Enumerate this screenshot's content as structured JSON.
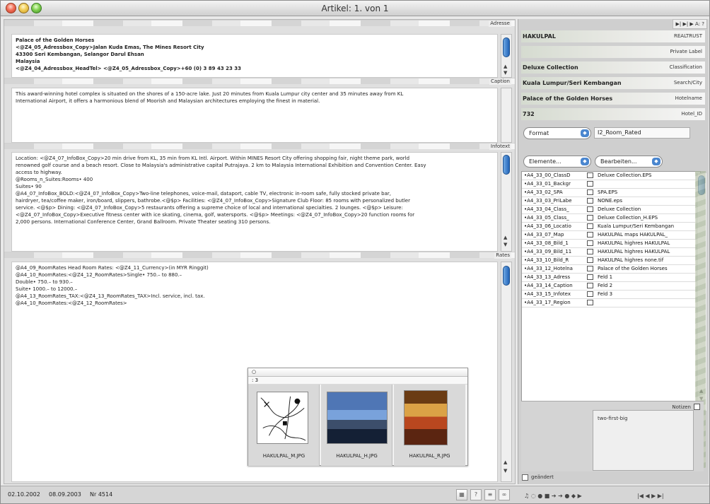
{
  "window": {
    "title": "Artikel: 1. von 1"
  },
  "left": {
    "sections": {
      "address_label": "Adresse",
      "caption_label": "Caption",
      "infotext_label": "Infotext",
      "rates_label": "Rates"
    },
    "address_lines": [
      "Palace of the Golden Horses",
      "<@Z4_05_Adressbox_Copy>Jalan Kuda Emas, The Mines Resort City",
      "43300 Seri Kembangan, Selangor Darul Ehsan",
      "Malaysia",
      "<@Z4_04_Adressbox_HeadTel> <@Z4_05_Adressbox_Copy>+60 (0) 3 89 43 23 33"
    ],
    "caption_lines": [
      "This award-winning hotel complex is situated on the shores of a 150-acre lake. Just 20 minutes from Kuala Lumpur city center and 35 minutes away from KL",
      "International Airport, it offers a harmonious blend of Moorish and Malaysian architectures employing the finest in material."
    ],
    "infotext_lines": [
      "Location: <@Z4_07_InfoBox_Copy>20 min drive from KL, 35 min from KL Intl. Airport. Within MINES Resort City offering shopping fair, night theme park, world",
      "renowned golf course and a beach resort. Close to Malaysia's administrative capital Putrajaya. 2 km to Malaysia International Exhibition and Convention Center. Easy",
      "access to highway.",
      "@Rooms_n_Suites:Rooms• 400",
      "Suites• 90",
      "@A4_07_InfoBox_BOLD:<@Z4_07_InfoBox_Copy>Two-line telephones, voice-mail, dataport, cable TV, electronic in-room safe, fully stocked private bar,",
      "hairdryer, tea/coffee maker, iron/board, slippers, bathrobe.<@$p> Facilities: <@Z4_07_InfoBox_Copy>Signature Club Floor: 85 rooms with personalized butler",
      "service. <@$p> Dining: <@Z4_07_InfoBox_Copy>5 restaurants offering a supreme choice of local and international specialties. 2 lounges. <@$p> Leisure:",
      "<@Z4_07_InfoBox_Copy>Executive fitness center with ice skating, cinema, golf, watersports. <@$p> Meetings: <@Z4_07_InfoBox_Copy>20 function rooms for",
      "2,000 persons. International Conference Center, Grand Ballroom. Private Theater seating 310 persons."
    ],
    "rates_lines": [
      "@A4_09_RoomRates Head Room Rates: <@Z4_11_Currency>(in MYR Ringgit)",
      "@A4_10_RoomRates:<@Z4_12_RoomRates>Single• 750.– to 880.–",
      "Double• 750.– to 930.–",
      "Suite• 1000.– to 12000.–",
      "@A4_13_RoomRates_TAX:<@Z4_13_RoomRates_TAX>Incl. service, incl. tax.",
      "@A4_10_RoomRates:<@Z4_12_RoomRates>"
    ]
  },
  "preview": {
    "title": "○",
    "subtitle": ": 3",
    "images": [
      {
        "name": "HAKULPAL_M.JPG"
      },
      {
        "name": "HAKULPAL_H.JPG"
      },
      {
        "name": "HAKULPAL_R.JPG"
      }
    ]
  },
  "right": {
    "meta": [
      {
        "left": "HAKULPAL",
        "right": "REALTRUST"
      },
      {
        "left": "",
        "right": "Private Label"
      },
      {
        "left": "Deluxe Collection",
        "right": "Classification"
      },
      {
        "left": "Kuala Lumpur/Seri Kembangan",
        "right": "Search/City"
      },
      {
        "left": "Palace of the Golden Horses",
        "right": "Hotelname"
      },
      {
        "left": "732",
        "right": "Hotel_ID"
      }
    ],
    "nav_tiny": "▶| ▶| ▶ A: ?",
    "format_select": "Format",
    "format_value": "I2_Room_Rated",
    "elements_select": "Elemente...",
    "edit_select": "Bearbeiten...",
    "list": [
      {
        "code": "•A4_33_00_ClassD",
        "value": "Deluxe Collection.EPS"
      },
      {
        "code": "•A4_33_01_Backgr",
        "value": ""
      },
      {
        "code": "•A4_33_02_SPA",
        "value": "SPA.EPS"
      },
      {
        "code": "•A4_33_03_PriLabe",
        "value": "NONE.eps"
      },
      {
        "code": "•A4_33_04_Class_",
        "value": "Deluxe Collection"
      },
      {
        "code": "•A4_33_05_Class_",
        "value": "Deluxe Collection_H.EPS"
      },
      {
        "code": "•A4_33_06_Locatio",
        "value": "Kuala Lumpur/Seri Kembangan"
      },
      {
        "code": "•A4_33_07_Map",
        "value": "HAKULPAL maps HAKULPAL_"
      },
      {
        "code": "•A4_33_08_Bild_1",
        "value": "HAKULPAL highres HAKULPAL"
      },
      {
        "code": "•A4_33_09_Bild_11",
        "value": "HAKULPAL highres HAKULPAL"
      },
      {
        "code": "•A4_33_10_Bild_R",
        "value": "HAKULPAL highres none.tif"
      },
      {
        "code": "•A4_33_12_Hotelna",
        "value": "Palace of the Golden Horses"
      },
      {
        "code": "•A4_33_13_Adress",
        "value": "Feld 1"
      },
      {
        "code": "•A4_33_14_Caption",
        "value": "Feld 2"
      },
      {
        "code": "•A4_33_15_Infotex",
        "value": "Feld 3"
      },
      {
        "code": "•A4_33_17_Region",
        "value": ""
      }
    ],
    "notes_label": "Notizen",
    "notes_text": "two-first-big",
    "checkbox_label": "geändert"
  },
  "status": {
    "date1": "02.10.2002",
    "date2": "08.09.2003",
    "number": "Nr 4514",
    "help": "?",
    "equal": "≡",
    "link": "∞"
  },
  "colors": {
    "accent_blue": "#2264b8",
    "meta_green": "#d5dbd0",
    "window_gray": "#e9e9e9"
  }
}
